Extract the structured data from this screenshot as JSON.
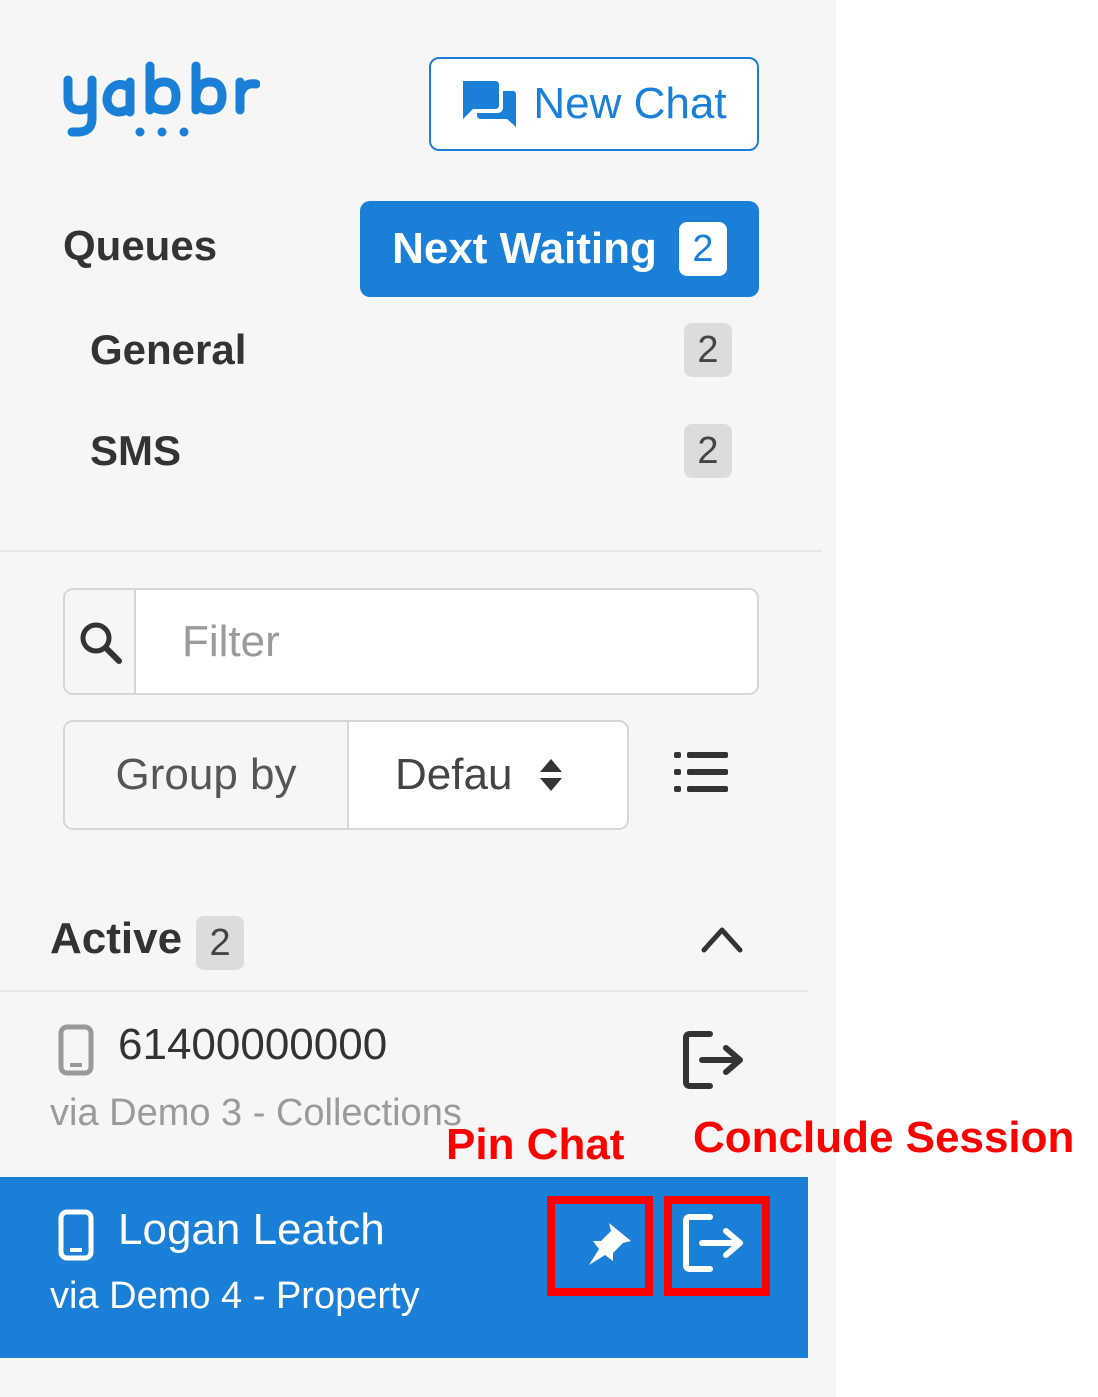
{
  "brand": {
    "logo_text": "yabbr",
    "accent_color": "#1a7fd6"
  },
  "header": {
    "new_chat_label": "New Chat",
    "new_chat_icon": "chat-bubbles-icon"
  },
  "queues": {
    "title": "Queues",
    "next_waiting_label": "Next Waiting",
    "next_waiting_count": "2",
    "items": [
      {
        "label": "General",
        "count": "2"
      },
      {
        "label": "SMS",
        "count": "2"
      }
    ]
  },
  "filter": {
    "placeholder": "Filter",
    "value": "",
    "icon": "search-icon"
  },
  "group_by": {
    "label": "Group by",
    "selected": "Defau",
    "icon": "sort-arrows-icon",
    "list_icon": "list-icon"
  },
  "active": {
    "title": "Active",
    "count": "2",
    "collapse_icon": "chevron-up-icon",
    "sessions": [
      {
        "name": "61400000000",
        "via": "via Demo 3 - Collections",
        "icon": "mobile-phone-icon",
        "selected": false
      },
      {
        "name": "Logan Leatch",
        "via": "via Demo 4 - Property",
        "icon": "mobile-phone-icon",
        "selected": true
      }
    ]
  },
  "annotations": {
    "pin_label": "Pin Chat",
    "conclude_label": "Conclude Session",
    "color": "#ff0000"
  }
}
